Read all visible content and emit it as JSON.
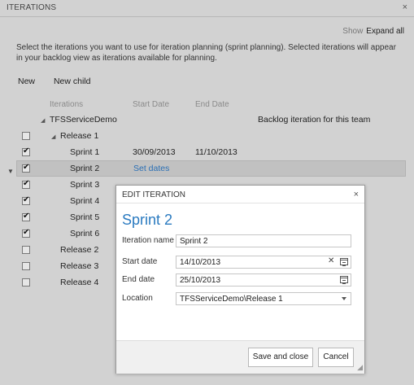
{
  "window": {
    "title": "ITERATIONS",
    "close": "×"
  },
  "show": {
    "label": "Show",
    "value": "Expand all"
  },
  "intro": "Select the iterations you want to use for iteration planning (sprint planning). Selected iterations will appear in your backlog view as iterations available for planning.",
  "toolbar": {
    "new": "New",
    "new_child": "New child"
  },
  "columns": {
    "iterations": "Iterations",
    "start": "Start Date",
    "end": "End Date"
  },
  "tree": {
    "root": "TFSServiceDemo",
    "root_note": "Backlog iteration for this team",
    "rows": [
      {
        "name": "Release 1",
        "checked": false,
        "start": "",
        "end": ""
      },
      {
        "name": "Sprint 1",
        "checked": true,
        "start": "30/09/2013",
        "end": "11/10/2013"
      },
      {
        "name": "Sprint 2",
        "checked": true,
        "start": "Set dates",
        "end": ""
      },
      {
        "name": "Sprint 3",
        "checked": true
      },
      {
        "name": "Sprint 4",
        "checked": true
      },
      {
        "name": "Sprint 5",
        "checked": true
      },
      {
        "name": "Sprint 6",
        "checked": true
      },
      {
        "name": "Release 2",
        "checked": false
      },
      {
        "name": "Release 3",
        "checked": false
      },
      {
        "name": "Release 4",
        "checked": false
      }
    ]
  },
  "dialog": {
    "title": "EDIT ITERATION",
    "close": "×",
    "heading": "Sprint 2",
    "iteration_name_label": "Iteration name",
    "iteration_name_value": "Sprint 2",
    "start_label": "Start date",
    "start_value": "14/10/2013",
    "end_label": "End date",
    "end_value": "25/10/2013",
    "location_label": "Location",
    "location_value": "TFSServiceDemo\\Release 1",
    "save_button": "Save and close",
    "cancel_button": "Cancel"
  },
  "colors": {
    "link": "#2a6fb5",
    "heading": "#2a7ac0",
    "selection": "#c1c1c1"
  }
}
